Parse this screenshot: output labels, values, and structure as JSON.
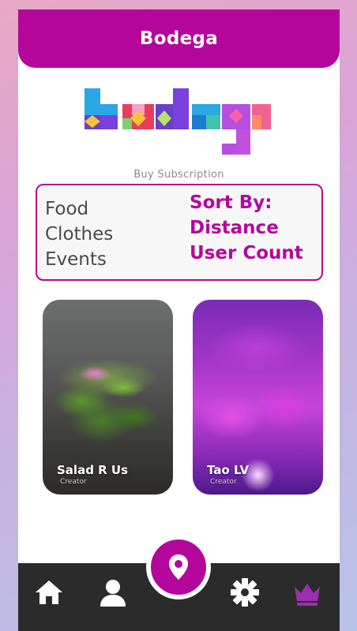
{
  "header": {
    "title": "Bodega"
  },
  "logo": {
    "text": "bodega"
  },
  "subscription": {
    "label": "Buy Subscription"
  },
  "filters": {
    "categories": [
      "Food",
      "Clothes",
      "Events"
    ],
    "sort_items": [
      "Sort By:",
      "Distance",
      "User Count"
    ]
  },
  "cards": [
    {
      "title": "Salad R Us",
      "subtitle": "Creator"
    },
    {
      "title": "Tao LV",
      "subtitle": "Creator"
    }
  ],
  "nav": {
    "items": [
      "home-icon",
      "user-icon",
      "map-pin-icon",
      "gear-icon",
      "crown-icon"
    ]
  },
  "colors": {
    "accent": "#b5069c",
    "navbar": "#2b2b2b"
  }
}
